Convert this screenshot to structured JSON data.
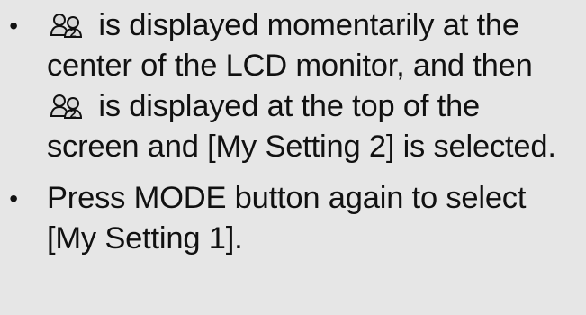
{
  "items": [
    {
      "bullet": "•",
      "icon": "my-setting-2-icon",
      "icon_label": "2",
      "text_a": " is displayed momentarily at the center of the LCD monitor, and then ",
      "text_b": " is displayed at the top of the screen and [My Setting 2] is selected."
    },
    {
      "bullet": "•",
      "text": "Press MODE button again to select [My Setting 1]."
    }
  ]
}
